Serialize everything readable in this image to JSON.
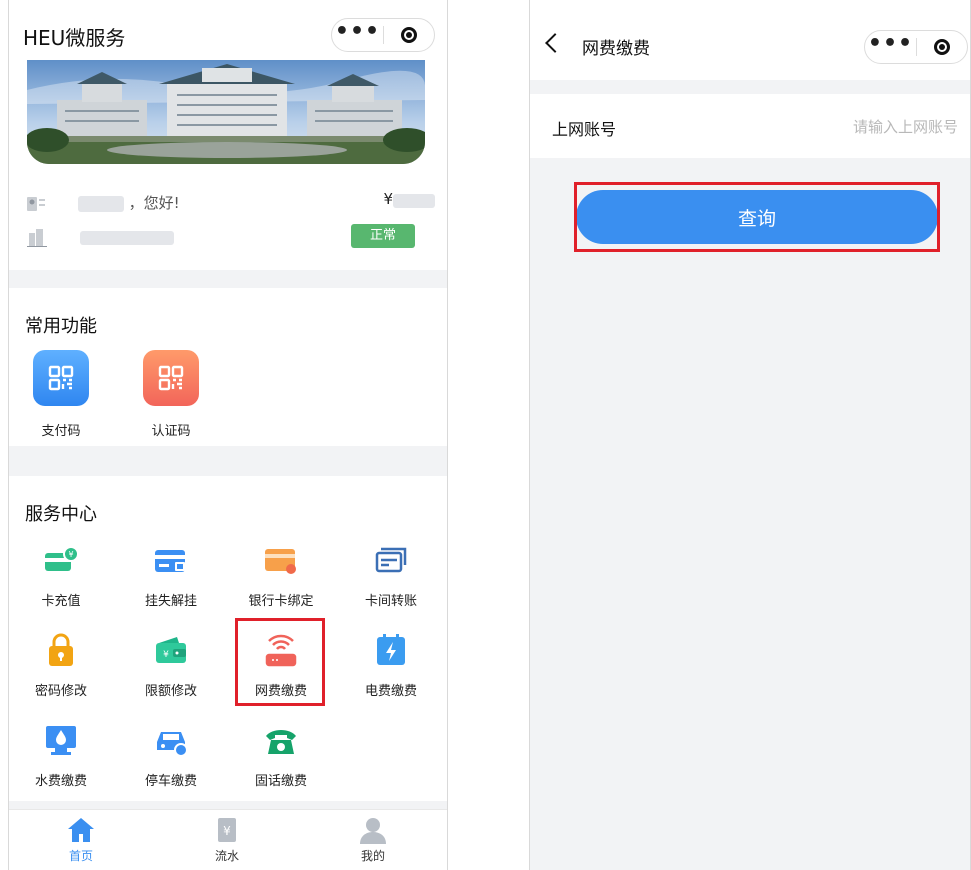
{
  "left_screen": {
    "app_title": "HEU微服务",
    "greeting_suffix": "，您好!",
    "currency_symbol": "¥",
    "status_badge": "正常",
    "common_section": {
      "title": "常用功能",
      "items": [
        {
          "label": "支付码",
          "icon": "qr-code-icon",
          "color": "#3b8ff3"
        },
        {
          "label": "认证码",
          "icon": "qr-code-icon",
          "color": "#f5785c"
        }
      ]
    },
    "service_section": {
      "title": "服务中心",
      "items": [
        {
          "label": "卡充值",
          "icon": "card-recharge-icon"
        },
        {
          "label": "挂失解挂",
          "icon": "card-lock-icon"
        },
        {
          "label": "银行卡绑定",
          "icon": "bank-card-icon"
        },
        {
          "label": "卡间转账",
          "icon": "card-transfer-icon"
        },
        {
          "label": "密码修改",
          "icon": "padlock-icon"
        },
        {
          "label": "限额修改",
          "icon": "wallet-icon"
        },
        {
          "label": "网费缴费",
          "icon": "wifi-router-icon"
        },
        {
          "label": "电费缴费",
          "icon": "electricity-icon"
        },
        {
          "label": "水费缴费",
          "icon": "water-monitor-icon"
        },
        {
          "label": "停车缴费",
          "icon": "car-icon"
        },
        {
          "label": "固话缴费",
          "icon": "telephone-icon"
        }
      ]
    },
    "tabbar": [
      {
        "label": "首页",
        "icon": "home-icon",
        "active": true
      },
      {
        "label": "流水",
        "icon": "receipt-icon",
        "active": false
      },
      {
        "label": "我的",
        "icon": "user-icon",
        "active": false
      }
    ],
    "highlight_color": "#e0202a"
  },
  "right_screen": {
    "page_title": "网费缴费",
    "field_label": "上网账号",
    "field_placeholder": "请输入上网账号",
    "field_value": "",
    "query_button": "查询",
    "accent_color": "#3a8ff0"
  }
}
